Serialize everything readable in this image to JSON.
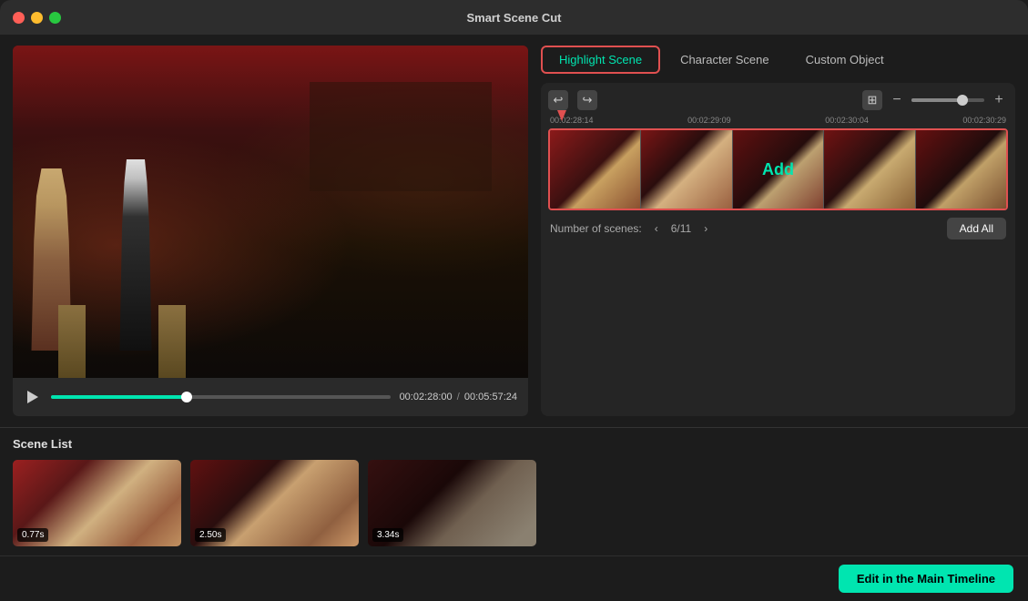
{
  "titlebar": {
    "title": "Smart Scene Cut"
  },
  "tabs": {
    "highlight": "Highlight Scene",
    "character": "Character Scene",
    "custom": "Custom Object"
  },
  "video": {
    "current_time": "00:02:28:00",
    "total_time": "00:05:57:24",
    "progress_percent": 40
  },
  "timeline": {
    "timestamps": [
      "00:02:28:14",
      "00:02:29:09",
      "00:02:30:04",
      "00:02:30:29"
    ],
    "add_label": "Add"
  },
  "scene_count": {
    "label": "Number of scenes:",
    "current": "6",
    "total": "11",
    "display": "6/11"
  },
  "buttons": {
    "add_all": "Add All",
    "edit_main": "Edit in the Main Timeline"
  },
  "scene_list": {
    "title": "Scene List",
    "items": [
      {
        "duration": "0.77s"
      },
      {
        "duration": "2.50s"
      },
      {
        "duration": "3.34s"
      }
    ]
  }
}
